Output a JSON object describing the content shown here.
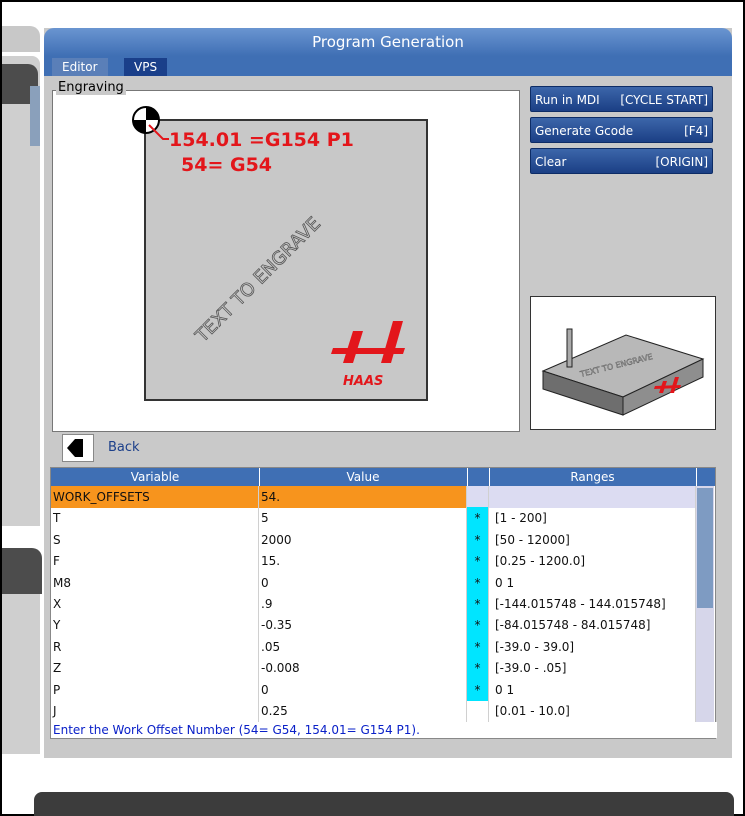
{
  "window": {
    "title": "Program Generation"
  },
  "tabs": [
    {
      "label": "Editor"
    },
    {
      "label": "VPS"
    }
  ],
  "engraving": {
    "legend": "Engraving",
    "offset_line1": "154.01 =G154 P1",
    "offset_line2": "54= G54",
    "engrave_text": "TEXT TO ENGRAVE",
    "logo_text": "HAAS"
  },
  "buttons": {
    "run_mdi": {
      "label": "Run in MDI",
      "key": "[CYCLE START]"
    },
    "generate": {
      "label": "Generate Gcode",
      "key": "[F4]"
    },
    "clear": {
      "label": "Clear",
      "key": "[ORIGIN]"
    }
  },
  "preview": {
    "engrave_text": "TEXT TO ENGRAVE"
  },
  "back": {
    "label": "Back"
  },
  "table": {
    "headers": [
      "Variable",
      "Value",
      "",
      "Ranges"
    ],
    "rows": [
      {
        "variable": "WORK_OFFSETS",
        "value": "54.",
        "flag": "",
        "range": ""
      },
      {
        "variable": "T",
        "value": "5",
        "flag": "*",
        "range": "[1 - 200]"
      },
      {
        "variable": "S",
        "value": "2000",
        "flag": "*",
        "range": "[50 - 12000]"
      },
      {
        "variable": "F",
        "value": "15.",
        "flag": "*",
        "range": "[0.25 - 1200.0]"
      },
      {
        "variable": "M8",
        "value": "0",
        "flag": "*",
        "range": "0 1"
      },
      {
        "variable": "X",
        "value": ".9",
        "flag": "*",
        "range": "[-144.015748 - 144.015748]"
      },
      {
        "variable": "Y",
        "value": "-0.35",
        "flag": "*",
        "range": "[-84.015748 - 84.015748]"
      },
      {
        "variable": "R",
        "value": ".05",
        "flag": "*",
        "range": "[-39.0 - 39.0]"
      },
      {
        "variable": "Z",
        "value": "-0.008",
        "flag": "*",
        "range": "[-39.0 - .05]"
      },
      {
        "variable": "P",
        "value": "0",
        "flag": "*",
        "range": "0 1"
      },
      {
        "variable": "J",
        "value": "0.25",
        "flag": "",
        "range": "[0.01 - 10.0]"
      }
    ]
  },
  "status": "Enter the Work Offset Number (54= G54, 154.01= G154 P1).",
  "colors": {
    "accent": "#3f6fb4",
    "selected_row": "#f7941d",
    "required_flag": "#00e5ff",
    "engrave_red": "#e3161b"
  }
}
